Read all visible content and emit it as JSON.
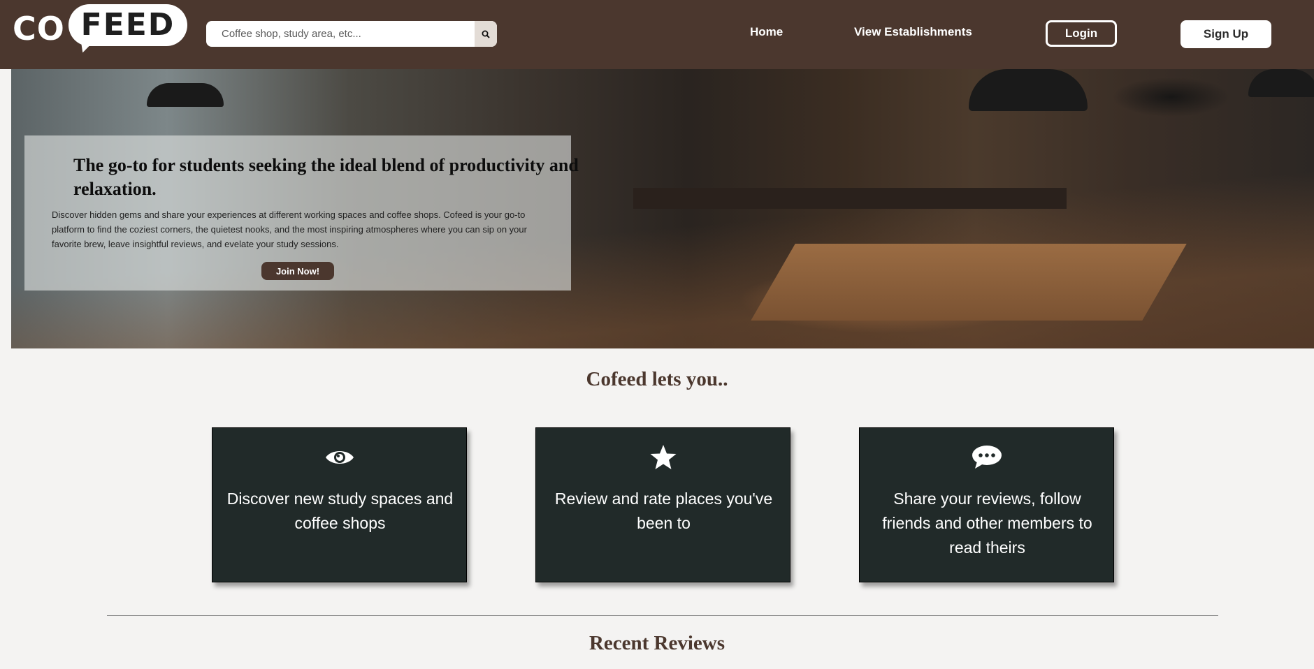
{
  "header": {
    "logo_co": "CO",
    "logo_feed": "FEED",
    "search_placeholder": "Coffee shop, study area, etc...",
    "nav": {
      "home": "Home",
      "establishments": "View Establishments",
      "login": "Login",
      "signup": "Sign Up"
    }
  },
  "hero": {
    "title": "The go-to for students seeking the ideal blend of productivity and relaxation.",
    "description": "Discover hidden gems and share your experiences at different working spaces and coffee shops. Cofeed is your go-to platform to find the coziest corners, the quietest nooks, and the most inspiring atmospheres where you can sip on your favorite brew, leave insightful reviews, and evelate your study sessions.",
    "cta": "Join Now!"
  },
  "features": {
    "title": "Cofeed lets you..",
    "cards": [
      {
        "icon": "eye-icon",
        "text": "Discover new study spaces and coffee shops"
      },
      {
        "icon": "star-icon",
        "text": "Review and rate places you've been to"
      },
      {
        "icon": "comment-icon",
        "text": "Share your reviews, follow friends and other members to read theirs"
      }
    ]
  },
  "reviews": {
    "title": "Recent Reviews"
  },
  "colors": {
    "brand_brown": "#4b372e",
    "card_dark": "#212a29",
    "page_bg": "#f4f3f2"
  }
}
